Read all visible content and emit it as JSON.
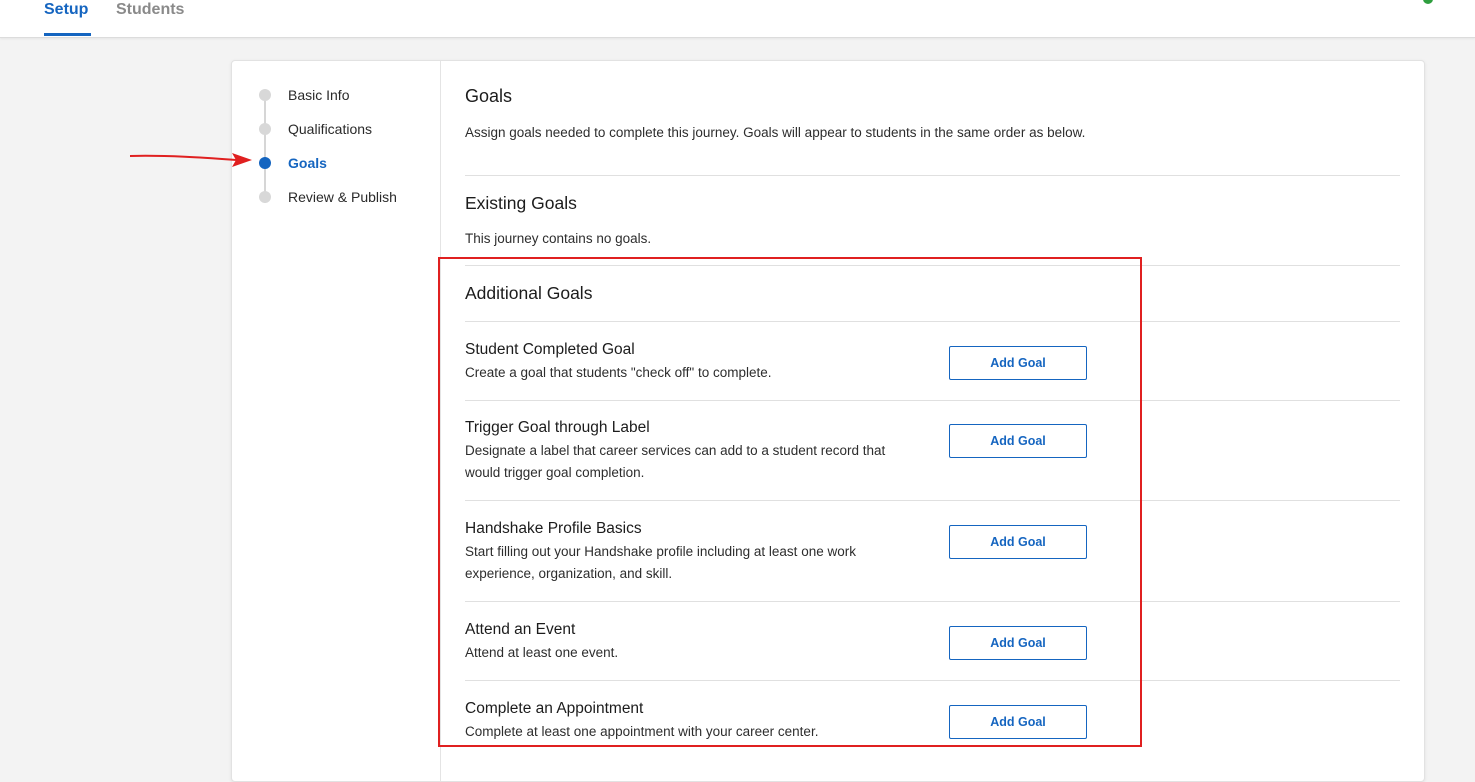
{
  "header": {
    "tabs": [
      {
        "label": "Setup",
        "active": true
      },
      {
        "label": "Students",
        "active": false
      }
    ],
    "accent_color": "#1565c0"
  },
  "stepper": {
    "steps": [
      {
        "label": "Basic Info",
        "active": false
      },
      {
        "label": "Qualifications",
        "active": false
      },
      {
        "label": "Goals",
        "active": true
      },
      {
        "label": "Review & Publish",
        "active": false
      }
    ]
  },
  "main": {
    "title": "Goals",
    "description": "Assign goals needed to complete this journey. Goals will appear to students in the same order as below.",
    "existing": {
      "title": "Existing Goals",
      "empty_text": "This journey contains no goals."
    },
    "additional": {
      "title": "Additional Goals",
      "items": [
        {
          "title": "Student Completed Goal",
          "description": "Create a goal that students \"check off\" to complete.",
          "button_label": "Add Goal"
        },
        {
          "title": "Trigger Goal through Label",
          "description": "Designate a label that career services can add to a student record that would trigger goal completion.",
          "button_label": "Add Goal"
        },
        {
          "title": "Handshake Profile Basics",
          "description": "Start filling out your Handshake profile including at least one work experience, organization, and skill.",
          "button_label": "Add Goal"
        },
        {
          "title": "Attend an Event",
          "description": "Attend at least one event.",
          "button_label": "Add Goal"
        },
        {
          "title": "Complete an Appointment",
          "description": "Complete at least one appointment with your career center.",
          "button_label": "Add Goal"
        }
      ]
    }
  },
  "annotation": {
    "color": "#e02020"
  }
}
